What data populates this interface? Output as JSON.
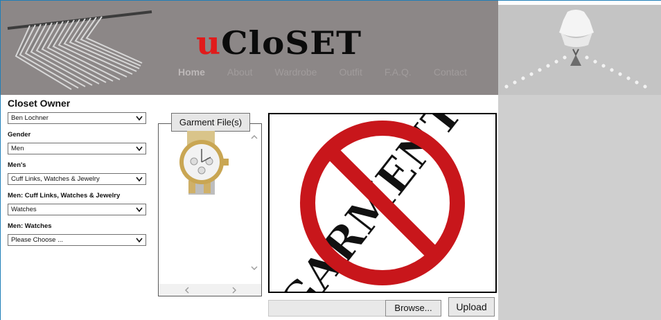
{
  "header": {
    "logo_first": "u",
    "logo_rest": "CloSET",
    "nav": [
      "Home",
      "About",
      "Wardrobe",
      "Outfit",
      "F.A.Q.",
      "Contact"
    ]
  },
  "form": {
    "title": "Closet Owner",
    "owner_value": "Ben Lochner",
    "gender_label": "Gender",
    "gender_value": "Men",
    "mens_label": "Men's",
    "mens_value": "Cuff Links, Watches & Jewelry",
    "subcat_label": "Men: Cuff Links, Watches & Jewelry",
    "subcat_value": "Watches",
    "watches_label": "Men: Watches",
    "watches_value": "Please Choose ..."
  },
  "garment": {
    "button_label": "Garment File(s)"
  },
  "preview": {
    "stamp_text": "GARMENT"
  },
  "upload": {
    "browse_label": "Browse...",
    "upload_label": "Upload"
  },
  "colors": {
    "header_bg": "#8c8787",
    "logo_red": "#e11b1b",
    "nav_text": "#a19c9c",
    "prohibit_red": "#c8161b",
    "side_panel": "#cfcfcf"
  }
}
